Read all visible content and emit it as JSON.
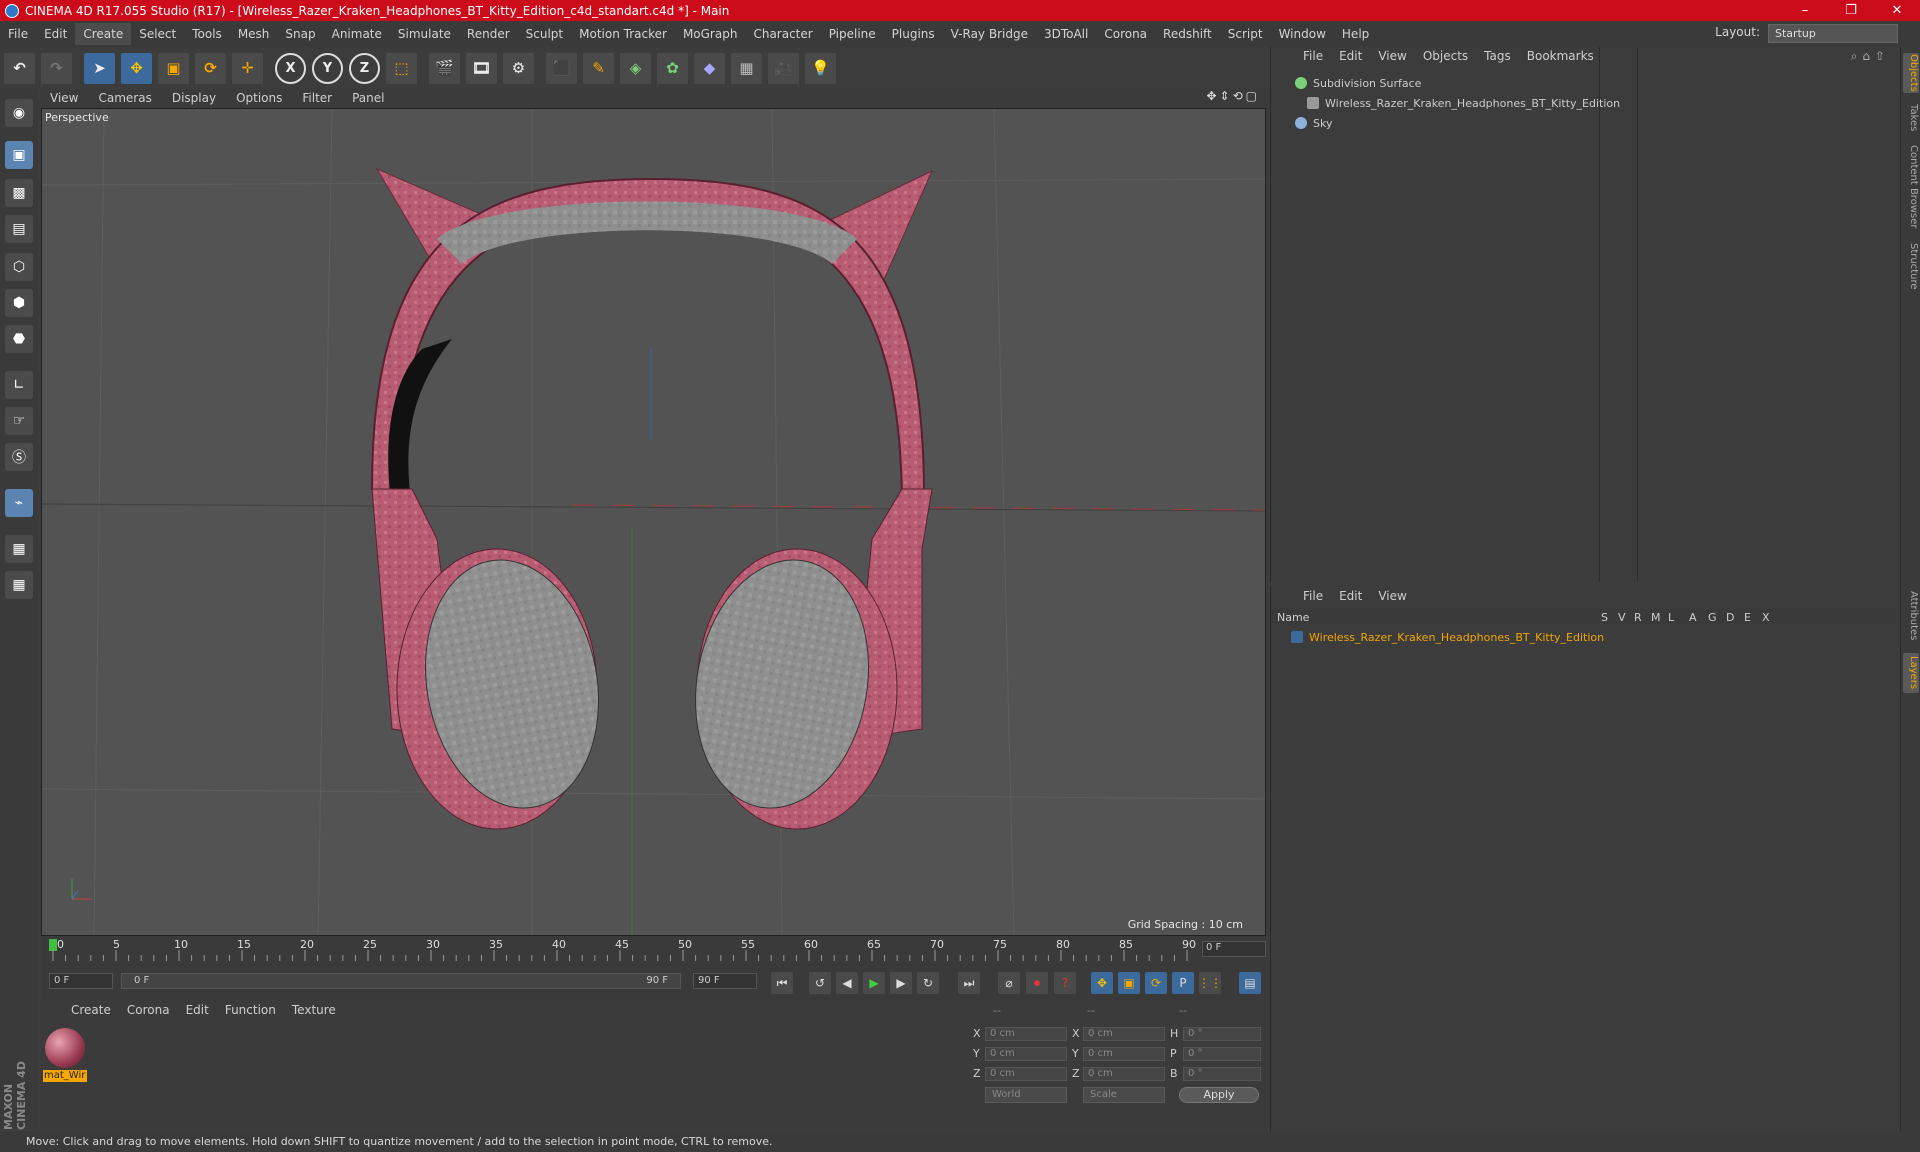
{
  "titlebar": {
    "title": "CINEMA 4D R17.055 Studio (R17) - [Wireless_Razer_Kraken_Headphones_BT_Kitty_Edition_c4d_standart.c4d *] - Main",
    "minimize": "–",
    "maximize": "❐",
    "close": "✕"
  },
  "menubar": {
    "items": [
      "File",
      "Edit",
      "Create",
      "Select",
      "Tools",
      "Mesh",
      "Snap",
      "Animate",
      "Simulate",
      "Render",
      "Sculpt",
      "Motion Tracker",
      "MoGraph",
      "Character",
      "Pipeline",
      "Plugins",
      "V-Ray Bridge",
      "3DToAll",
      "Corona",
      "Redshift",
      "Script",
      "Window",
      "Help"
    ],
    "active_index": 2,
    "layout_label": "Layout:",
    "layout_value": "Startup"
  },
  "toolbar": {
    "axis_x": "X",
    "axis_y": "Y",
    "axis_z": "Z"
  },
  "viewport": {
    "menu": [
      "View",
      "Cameras",
      "Display",
      "Options",
      "Filter",
      "Panel"
    ],
    "label": "Perspective",
    "grid_spacing": "Grid Spacing : 10 cm",
    "nav_icons": "✥⇕⟲▢"
  },
  "timeline": {
    "ticks": [
      "0",
      "5",
      "10",
      "15",
      "20",
      "25",
      "30",
      "35",
      "40",
      "45",
      "50",
      "55",
      "60",
      "65",
      "70",
      "75",
      "80",
      "85",
      "90"
    ],
    "current_field": "0 F",
    "start_field": "0 F",
    "range_start": "0 F",
    "range_end": "90 F",
    "end_field": "90 F"
  },
  "material_panel": {
    "menu": [
      "Create",
      "Corona",
      "Edit",
      "Function",
      "Texture"
    ],
    "material_name": "mat_Wir"
  },
  "coord_panel": {
    "header": [
      "--",
      "--",
      "--"
    ],
    "rows": [
      {
        "a": "X",
        "v1": "0 cm",
        "b": "X",
        "v2": "0 cm",
        "c": "H",
        "v3": "0 °"
      },
      {
        "a": "Y",
        "v1": "0 cm",
        "b": "Y",
        "v2": "0 cm",
        "c": "P",
        "v3": "0 °"
      },
      {
        "a": "Z",
        "v1": "0 cm",
        "b": "Z",
        "v2": "0 cm",
        "c": "B",
        "v3": "0 °"
      }
    ],
    "space_select": "World",
    "mode_select": "Scale",
    "apply": "Apply"
  },
  "object_manager": {
    "menu": [
      "File",
      "Edit",
      "View",
      "Objects",
      "Tags",
      "Bookmarks"
    ],
    "objects": [
      {
        "name": "Subdivision Surface",
        "color": "#7ad17a"
      },
      {
        "name": "Wireless_Razer_Kraken_Headphones_BT_Kitty_Edition",
        "color": "#9a9a9a"
      },
      {
        "name": "Sky",
        "color": "#8fb0d9"
      }
    ]
  },
  "layer_manager": {
    "menu": [
      "File",
      "Edit",
      "View"
    ],
    "columns": [
      "Name",
      "S",
      "V",
      "R",
      "M",
      "L",
      "A",
      "G",
      "D",
      "E",
      "X"
    ],
    "layer_name": "Wireless_Razer_Kraken_Headphones_BT_Kitty_Edition",
    "layer_color": "#f2a600"
  },
  "right_tabs": [
    "Objects",
    "Takes",
    "Content Browser",
    "Structure",
    "Attributes",
    "Layers"
  ],
  "statusbar": {
    "text": "Move: Click and drag to move elements. Hold down SHIFT to quantize movement / add to the selection in point mode, CTRL to remove."
  },
  "branding": {
    "maxon": "MAXON CINEMA 4D"
  }
}
